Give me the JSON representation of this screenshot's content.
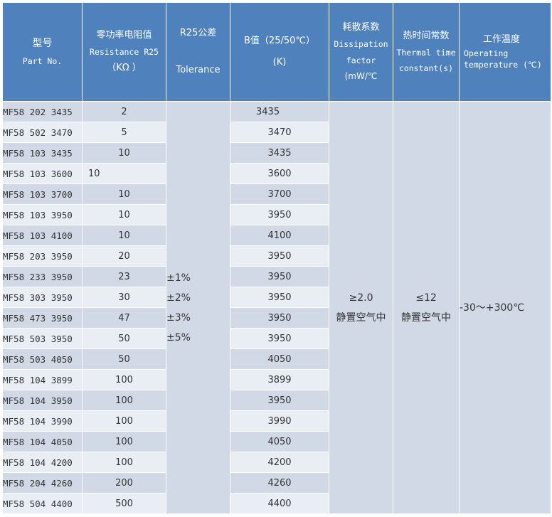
{
  "header": {
    "part": [
      "型号",
      "Part No."
    ],
    "resistance": [
      "零功率电阻值",
      "Resistance R25",
      "（KΩ ）"
    ],
    "tolerance": [
      "R25公差",
      "Tolerance"
    ],
    "bvalue": [
      "B值（25/50℃）",
      "(K)"
    ],
    "dissipation": [
      "耗散系数",
      "Dissipation",
      "factor",
      "(mW/℃"
    ],
    "thermal": [
      "热时间常数",
      "Thermal time",
      "constant(s)"
    ],
    "operating": [
      "工作温度",
      "Operating",
      "temperature (℃)"
    ]
  },
  "rows": [
    {
      "part": "MF58 202 3435",
      "res": "2",
      "b": "3435"
    },
    {
      "part": "MF58 502 3470",
      "res": "5",
      "b": "3470"
    },
    {
      "part": "MF58 103 3435",
      "res": "10",
      "b": "3435"
    },
    {
      "part": "MF58 103 3600",
      "res": "10",
      "b": "3600"
    },
    {
      "part": "MF58 103 3700",
      "res": "10",
      "b": "3700"
    },
    {
      "part": "MF58 103 3950",
      "res": "10",
      "b": "3950"
    },
    {
      "part": "MF58 103 4100",
      "res": "10",
      "b": "4100"
    },
    {
      "part": "MF58 203 3950",
      "res": "20",
      "b": "3950"
    },
    {
      "part": "MF58 233 3950",
      "res": "23",
      "b": "3950"
    },
    {
      "part": "MF58 303 3950",
      "res": "30",
      "b": "3950"
    },
    {
      "part": "MF58 473 3950",
      "res": "47",
      "b": "3950"
    },
    {
      "part": "MF58 503 3950",
      "res": "50",
      "b": "3950"
    },
    {
      "part": "MF58 503 4050",
      "res": "50",
      "b": "4050"
    },
    {
      "part": "MF58 104 3899",
      "res": "100",
      "b": "3899"
    },
    {
      "part": "MF58 104 3950",
      "res": "100",
      "b": "3950"
    },
    {
      "part": "MF58 104 3990",
      "res": "100",
      "b": "3990"
    },
    {
      "part": "MF58 104 4050",
      "res": "100",
      "b": "4050"
    },
    {
      "part": "MF58 104 4200",
      "res": "100",
      "b": "4200"
    },
    {
      "part": "MF58 204 4260",
      "res": "200",
      "b": "4260"
    },
    {
      "part": "MF58 504 4400",
      "res": "500",
      "b": "4400"
    }
  ],
  "merged": {
    "tolerance": [
      "±1%",
      "±2%",
      "±3%",
      "±5%"
    ],
    "dissipation": [
      "≥2.0",
      "静置空气中"
    ],
    "thermal": [
      "≤12",
      "静置空气中"
    ],
    "operating": "-30～+300℃"
  }
}
